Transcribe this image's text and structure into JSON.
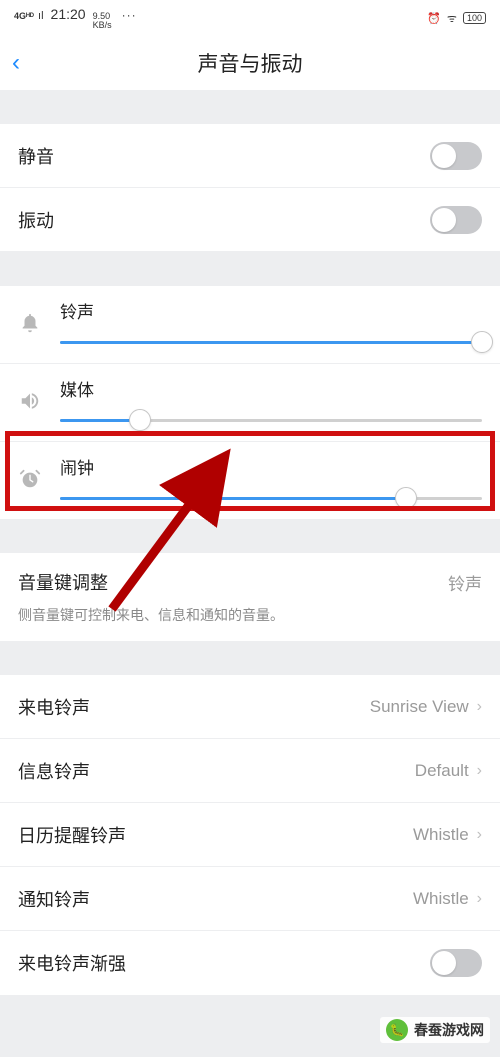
{
  "status": {
    "network": "4Gᴴᴰ",
    "time": "21:20",
    "speed_up": "9.50",
    "speed_unit": "KB/s",
    "dots": "···",
    "alarm_icon": "⏰",
    "wifi_icon": "ᯤ",
    "battery": "100"
  },
  "header": {
    "back": "‹",
    "title": "声音与振动"
  },
  "toggles": {
    "mute": "静音",
    "vibrate": "振动"
  },
  "sliders": {
    "ring": {
      "label": "铃声",
      "icon": "🔔",
      "pct": 100
    },
    "media": {
      "label": "媒体",
      "icon": "🔊",
      "pct": 19
    },
    "alarm": {
      "label": "闹钟",
      "icon": "⏰",
      "pct": 82
    }
  },
  "volkey": {
    "label": "音量键调整",
    "value": "铃声",
    "desc": "侧音量键可控制来电、信息和通知的音量。"
  },
  "ringtones": {
    "call": {
      "label": "来电铃声",
      "value": "Sunrise View"
    },
    "msg": {
      "label": "信息铃声",
      "value": "Default"
    },
    "cal": {
      "label": "日历提醒铃声",
      "value": "Whistle"
    },
    "notif": {
      "label": "通知铃声",
      "value": "Whistle"
    },
    "fade": "来电铃声渐强"
  },
  "watermark": "春蚕游戏网"
}
